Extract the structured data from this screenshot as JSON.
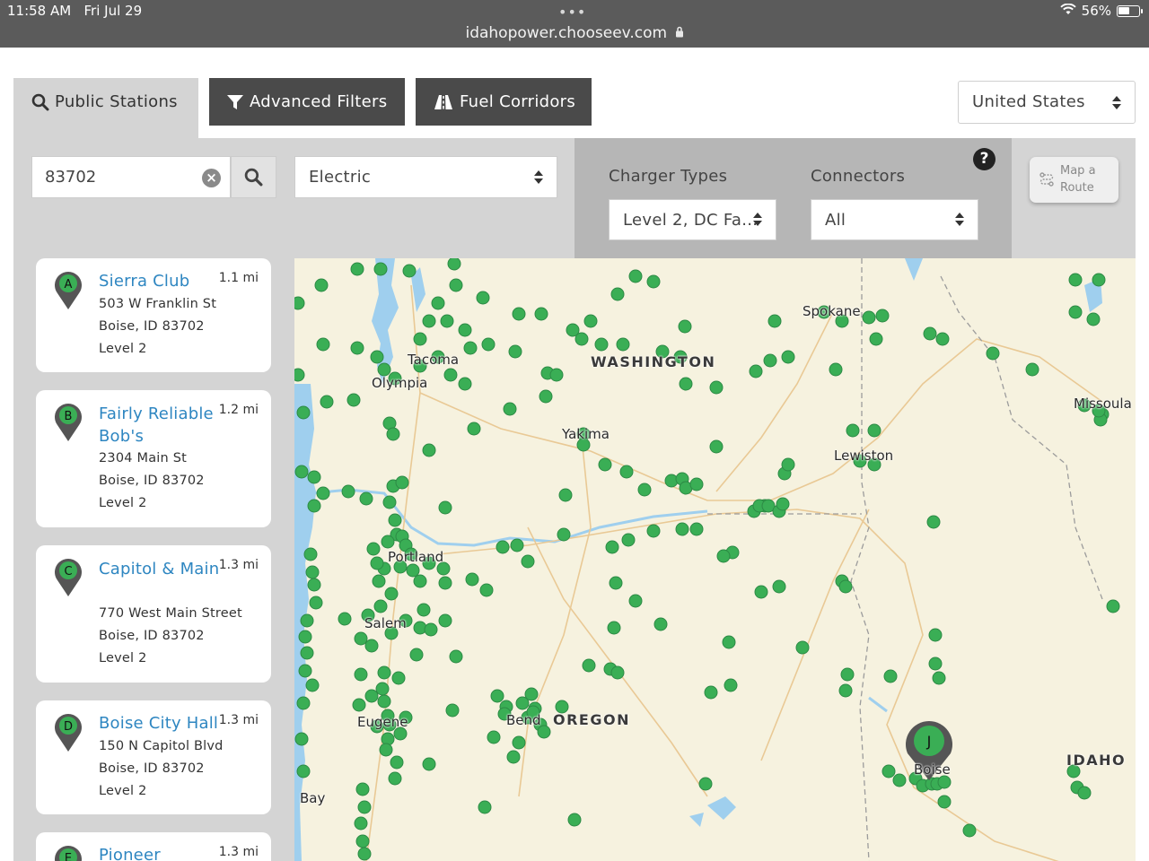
{
  "status_bar": {
    "time": "11:58 AM",
    "date": "Fri Jul 29",
    "dots": "•••",
    "url": "idahopower.chooseev.com",
    "battery": "56%",
    "battery_level": 0.56
  },
  "tabs": {
    "public_stations": "Public Stations",
    "advanced_filters": "Advanced Filters",
    "fuel_corridors": "Fuel Corridors"
  },
  "country_select": {
    "value": "United States"
  },
  "search": {
    "zip": "83702"
  },
  "fuel_select": {
    "value": "Electric"
  },
  "charger_types": {
    "label": "Charger Types",
    "value": "Level 2, DC Fa..."
  },
  "connectors": {
    "label": "Connectors",
    "value": "All"
  },
  "help_label": "?",
  "map_route": {
    "line1": "Map a",
    "line2": "Route"
  },
  "stations": [
    {
      "letter": "A",
      "name": "Sierra Club",
      "distance": "1.1 mi",
      "address": "503 W Franklin St",
      "city": "Boise, ID 83702",
      "level": "Level 2"
    },
    {
      "letter": "B",
      "name": "Fairly Reliable Bob's",
      "distance": "1.2 mi",
      "address": "2304 Main St",
      "city": "Boise, ID 83702",
      "level": "Level 2"
    },
    {
      "letter": "C",
      "name": "Capitol & Main",
      "distance": "1.3 mi",
      "address": "770 West Main Street",
      "city": "Boise, ID 83702",
      "level": "Level 2"
    },
    {
      "letter": "D",
      "name": "Boise City Hall",
      "distance": "1.3 mi",
      "address": "150 N Capitol Blvd",
      "city": "Boise, ID 83702",
      "level": "Level 2"
    },
    {
      "letter": "E",
      "name": "Pioneer",
      "distance": "1.3 mi",
      "address": "",
      "city": "",
      "level": ""
    }
  ],
  "map": {
    "selected_marker": "J",
    "colors": {
      "marker": "#3aae55",
      "water": "#9fcfee",
      "land": "#f6f2df"
    },
    "labels": {
      "spokane": "Spokane",
      "washington": "WASHINGTON",
      "tacoma": "Tacoma",
      "olympia": "Olympia",
      "yakima": "Yakima",
      "lewiston": "Lewiston",
      "missoula": "Missoula",
      "portland": "Portland",
      "salem": "Salem",
      "eugene": "Eugene",
      "bend": "Bend",
      "oregon": "OREGON",
      "boise": "Boise",
      "idaho": "IDAHO",
      "coos_bay": "Bay"
    }
  }
}
